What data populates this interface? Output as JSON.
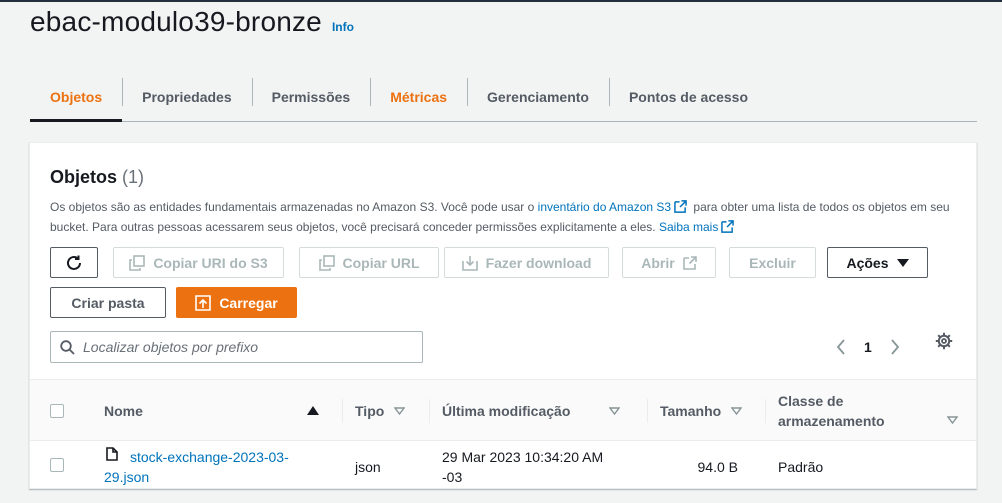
{
  "bucket": {
    "title": "ebac-modulo39-bronze",
    "info": "Info"
  },
  "tabs": [
    {
      "label": "Objetos"
    },
    {
      "label": "Propriedades"
    },
    {
      "label": "Permissões"
    },
    {
      "label": "Métricas"
    },
    {
      "label": "Gerenciamento"
    },
    {
      "label": "Pontos de acesso"
    }
  ],
  "objects_panel": {
    "heading": "Objetos",
    "count": "(1)",
    "desc_1": "Os objetos são as entidades fundamentais armazenadas no Amazon S3. Você pode usar o ",
    "inventory_link": "inventário do Amazon S3",
    "desc_2": " para obter uma lista de todos os objetos em seu bucket. Para outras pessoas acessarem seus objetos, você precisará conceder permissões explicitamente a eles. ",
    "learn_more": "Saiba mais"
  },
  "toolbar": {
    "copy_uri": "Copiar URI do S3",
    "copy_url": "Copiar URL",
    "download": "Fazer download",
    "open": "Abrir",
    "delete": "Excluir",
    "actions": "Ações",
    "create_folder": "Criar pasta",
    "upload": "Carregar"
  },
  "search": {
    "placeholder": "Localizar objetos por prefixo"
  },
  "pagination": {
    "page": "1"
  },
  "table": {
    "columns": {
      "name": "Nome",
      "type": "Tipo",
      "modified": "Última modificação",
      "size": "Tamanho",
      "storage_1": "Classe de",
      "storage_2": "armazenamento"
    },
    "rows": [
      {
        "name_1": "stock-exchange-2023-03-",
        "name_2": "29.json",
        "type": "json",
        "modified_1": "29 Mar 2023 10:34:20 AM",
        "modified_2": "-03",
        "size": "94.0 B",
        "storage": "Padrão"
      }
    ]
  },
  "colors": {
    "accent": "#ec7211",
    "link": "#0073bb",
    "text": "#16191f",
    "muted": "#545b64"
  }
}
